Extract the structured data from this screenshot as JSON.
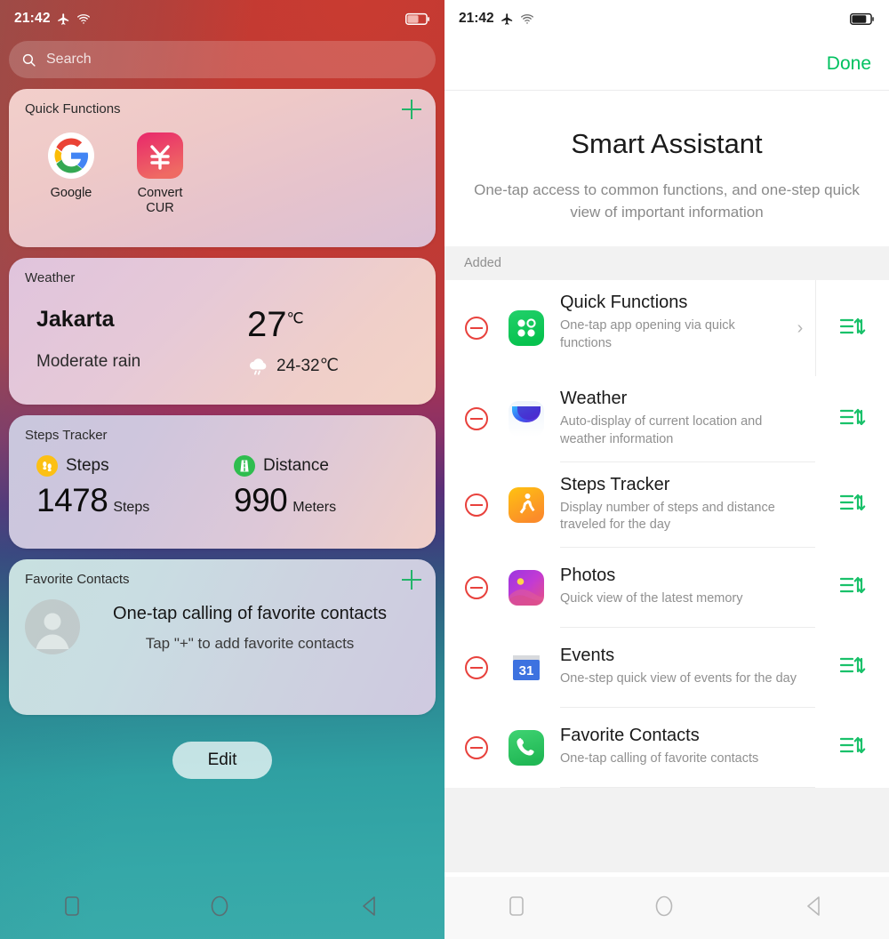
{
  "left": {
    "status": {
      "time": "21:42",
      "airplane_icon": "airplane-icon",
      "wifi_icon": "wifi-icon",
      "battery_icon": "battery-icon"
    },
    "search": {
      "placeholder": "Search",
      "icon": "search-icon"
    },
    "cards": {
      "quick_functions": {
        "title": "Quick Functions",
        "add_label": "+",
        "apps": [
          {
            "label": "Google",
            "icon": "google-icon"
          },
          {
            "label": "Convert CUR",
            "icon": "currency-convert-icon"
          }
        ]
      },
      "weather": {
        "title": "Weather",
        "city": "Jakarta",
        "condition": "Moderate rain",
        "temperature": "27",
        "temperature_unit": "℃",
        "range": "24-32℃",
        "range_icon": "rain-cloud-icon"
      },
      "steps_tracker": {
        "title": "Steps Tracker",
        "metrics": [
          {
            "label": "Steps",
            "value": "1478",
            "unit": "Steps",
            "icon": "footsteps-icon"
          },
          {
            "label": "Distance",
            "value": "990",
            "unit": "Meters",
            "icon": "road-icon"
          }
        ]
      },
      "favorite_contacts": {
        "title": "Favorite Contacts",
        "add_label": "+",
        "avatar_icon": "person-avatar-icon",
        "line1": "One-tap calling of favorite contacts",
        "line2": "Tap \"+\" to add favorite contacts"
      }
    },
    "edit_button": "Edit",
    "nav": [
      {
        "name": "recents-button",
        "icon": "square-icon"
      },
      {
        "name": "home-button",
        "icon": "circle-icon"
      },
      {
        "name": "back-button",
        "icon": "triangle-back-icon"
      }
    ]
  },
  "right": {
    "status": {
      "time": "21:42",
      "airplane_icon": "airplane-icon",
      "wifi_icon": "wifi-icon",
      "battery_icon": "battery-icon"
    },
    "done_label": "Done",
    "hero": {
      "title": "Smart Assistant",
      "subtitle": "One-tap access to common functions, and one-step quick view of important information"
    },
    "section_label": "Added",
    "items": [
      {
        "title": "Quick Functions",
        "desc": "One-tap app opening via quick functions",
        "icon": "quick-functions-app-icon",
        "has_chevron": true,
        "chevron": "›",
        "reorder_icon": "reorder-handle-icon",
        "remove_icon": "remove-circle-icon"
      },
      {
        "title": "Weather",
        "desc": "Auto-display of current location and weather information",
        "icon": "weather-app-icon",
        "has_chevron": false,
        "chevron": "",
        "reorder_icon": "reorder-handle-icon",
        "remove_icon": "remove-circle-icon"
      },
      {
        "title": "Steps Tracker",
        "desc": "Display number of steps and distance traveled for the day",
        "icon": "steps-tracker-app-icon",
        "has_chevron": false,
        "chevron": "",
        "reorder_icon": "reorder-handle-icon",
        "remove_icon": "remove-circle-icon"
      },
      {
        "title": "Photos",
        "desc": "Quick view of the latest memory",
        "icon": "photos-app-icon",
        "has_chevron": false,
        "chevron": "",
        "reorder_icon": "reorder-handle-icon",
        "remove_icon": "remove-circle-icon"
      },
      {
        "title": "Events",
        "desc": "One-step quick view of events for the day",
        "icon": "calendar-app-icon",
        "has_chevron": false,
        "chevron": "",
        "reorder_icon": "reorder-handle-icon",
        "remove_icon": "remove-circle-icon"
      },
      {
        "title": "Favorite Contacts",
        "desc": "One-tap calling of favorite contacts",
        "icon": "phone-app-icon",
        "has_chevron": false,
        "chevron": "",
        "reorder_icon": "reorder-handle-icon",
        "remove_icon": "remove-circle-icon"
      }
    ],
    "nav": [
      {
        "name": "recents-button",
        "icon": "square-icon"
      },
      {
        "name": "home-button",
        "icon": "circle-icon"
      },
      {
        "name": "back-button",
        "icon": "triangle-back-icon"
      }
    ]
  },
  "colors": {
    "accent_green": "#00c160",
    "remove_red": "#e8413c",
    "left_bg_top": "#c6392f",
    "left_bg_mid": "#5a2f78",
    "left_bg_bottom": "#3aabaa"
  }
}
